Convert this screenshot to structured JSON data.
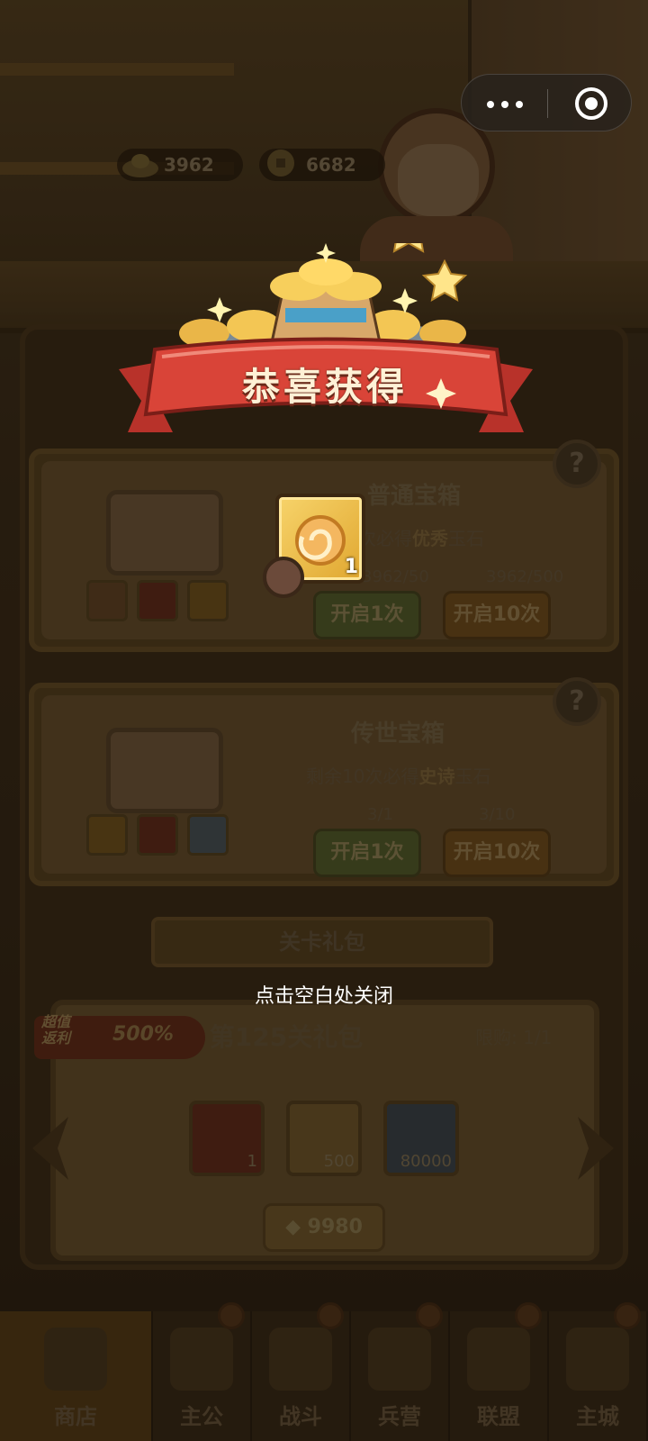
{
  "currencies": [
    {
      "icon": "gold-ingot-icon",
      "value": "3962"
    },
    {
      "icon": "copper-coin-icon",
      "value": "6682"
    }
  ],
  "capsule": {
    "more_icon": "more-dots-icon",
    "close_icon": "target-close-icon"
  },
  "reward_popup": {
    "title": "恭喜获得",
    "item": {
      "icon": "jade-spiral-icon",
      "count": "1",
      "badge_icon": "ox-head-badge-icon"
    },
    "close_hint": "点击空白处关闭"
  },
  "shop": {
    "normal_chest": {
      "title": "普通宝箱",
      "guarantee_prefix": "次必得",
      "guarantee_quality": "优秀",
      "guarantee_suffix": "玉石",
      "price_single": "3962/50",
      "price_ten": "3962/500",
      "open_once": "开启1次",
      "open_ten": "开启10次"
    },
    "legend_chest": {
      "title": "传世宝箱",
      "guarantee_prefix": "剩余10次必得",
      "guarantee_quality": "史诗",
      "guarantee_suffix": "玉石",
      "key_single": "3/1",
      "key_ten": "3/10",
      "open_once": "开启1次",
      "open_ten": "开启10次"
    },
    "stage_pack_header": "关卡礼包",
    "stage_pack": {
      "bonus_label": "超值返利",
      "bonus_value": "500%",
      "title": "第125关礼包",
      "limit": "限购: 1/1",
      "items": [
        {
          "icon": "treasure-scroll-icon",
          "count": "1"
        },
        {
          "icon": "silver-ore-icon",
          "count": "500"
        },
        {
          "icon": "copper-coin-icon",
          "count": "80000"
        }
      ],
      "price": "9980"
    }
  },
  "nav": [
    {
      "label": "商店",
      "icon": "shop-icon",
      "active": true
    },
    {
      "label": "主公",
      "icon": "lord-icon"
    },
    {
      "label": "战斗",
      "icon": "battle-icon"
    },
    {
      "label": "兵营",
      "icon": "barracks-icon"
    },
    {
      "label": "联盟",
      "icon": "alliance-icon"
    },
    {
      "label": "主城",
      "icon": "city-icon"
    }
  ]
}
